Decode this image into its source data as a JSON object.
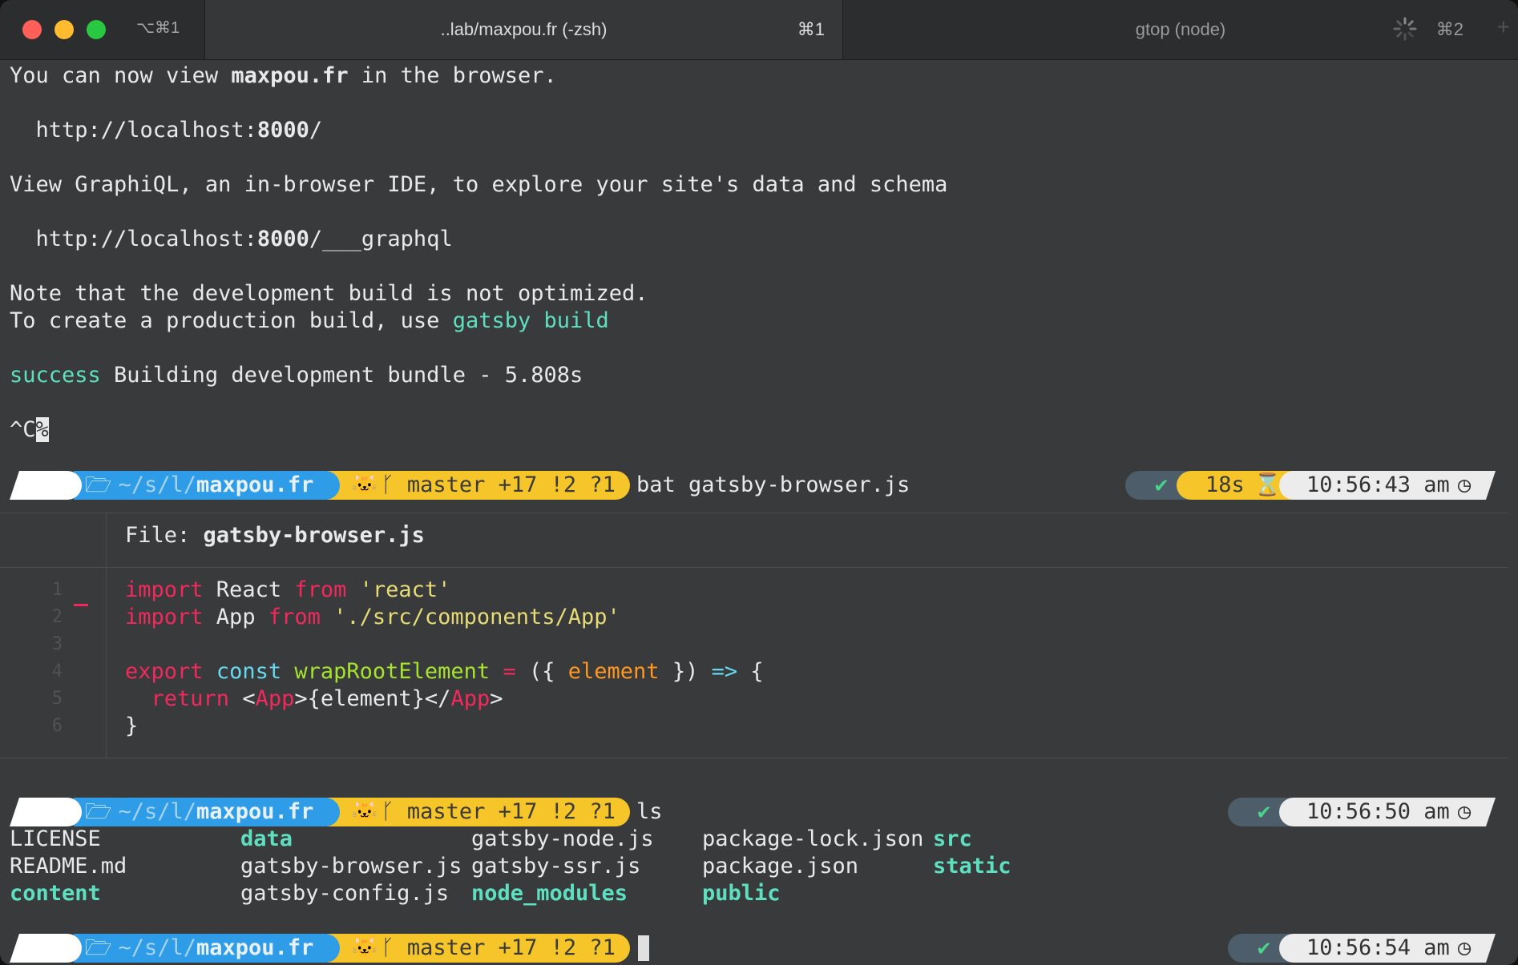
{
  "tabbar": {
    "window_shortcut": "⌥⌘1",
    "tabs": [
      {
        "title": "..lab/maxpou.fr (-zsh)",
        "shortcut": "⌘1",
        "active": true
      },
      {
        "title": "gtop (node)",
        "shortcut": "⌘2",
        "active": false
      }
    ],
    "new_tab": "+"
  },
  "output": {
    "line1_pre": "You can now view ",
    "line1_bold": "maxpou.fr",
    "line1_post": " in the browser.",
    "url1_pre": "  http://localhost:",
    "url1_bold": "8000",
    "url1_post": "/",
    "graphiql": "View GraphiQL, an in-browser IDE, to explore your site's data and schema",
    "url2_pre": "  http://localhost:",
    "url2_bold": "8000",
    "url2_post": "/___graphql",
    "note": "Note that the development build is not optimized.",
    "prod_pre": "To create a production build, use ",
    "prod_cmd": "gatsby build",
    "success_word": "success",
    "success_rest": " Building development bundle - 5.808s",
    "interrupt": "^C",
    "interrupt_mark": "%"
  },
  "prompt": {
    "apple_icon": "",
    "folder_icon": "🗁",
    "path_dim": "~/s/l/",
    "path_bold": "maxpou.fr",
    "git_icon": "🐱",
    "branch_icon": "ᚴ",
    "git_status": "master +17 !2 ?1",
    "check": "✔",
    "hourglass": "⌛",
    "clock": "◷"
  },
  "prompts": [
    {
      "command": "bat gatsby-browser.js",
      "duration": "18s",
      "time": "10:56:43 am"
    },
    {
      "command": "ls",
      "time": "10:56:50 am"
    },
    {
      "command": "",
      "time": "10:56:54 am"
    }
  ],
  "bat": {
    "file_label": "File: ",
    "file_name": "gatsby-browser.js",
    "line_numbers": [
      "1",
      "2",
      "3",
      "4",
      "5",
      "6"
    ],
    "code": {
      "l1_import": "import",
      "l1_mid": " React ",
      "l1_from": "from",
      "l1_str": " 'react'",
      "l2_import": "import",
      "l2_mid": " App ",
      "l2_from": "from",
      "l2_str": " './src/components/App'",
      "l4_export": "export",
      "l4_const": "const",
      "l4_name": "wrapRootElement",
      "l4_eq": " = ",
      "l4_paren": "({ ",
      "l4_param": "element",
      "l4_close": " }) ",
      "l4_arrow": "=>",
      "l4_brace": " {",
      "l5_return": "return",
      "l5_lt": " <",
      "l5_tag": "App",
      "l5_mid": ">{element}</",
      "l5_tag2": "App",
      "l5_gt": ">",
      "l6": "}"
    }
  },
  "ls": {
    "items": [
      {
        "name": "LICENSE",
        "dir": false
      },
      {
        "name": "README.md",
        "dir": false
      },
      {
        "name": "content",
        "dir": true
      },
      {
        "name": "data",
        "dir": true
      },
      {
        "name": "gatsby-browser.js",
        "dir": false
      },
      {
        "name": "gatsby-config.js",
        "dir": false
      },
      {
        "name": "gatsby-node.js",
        "dir": false
      },
      {
        "name": "gatsby-ssr.js",
        "dir": false
      },
      {
        "name": "node_modules",
        "dir": true
      },
      {
        "name": "package-lock.json",
        "dir": false
      },
      {
        "name": "package.json",
        "dir": false
      },
      {
        "name": "public",
        "dir": true
      },
      {
        "name": "src",
        "dir": true
      },
      {
        "name": "static",
        "dir": true
      }
    ]
  }
}
